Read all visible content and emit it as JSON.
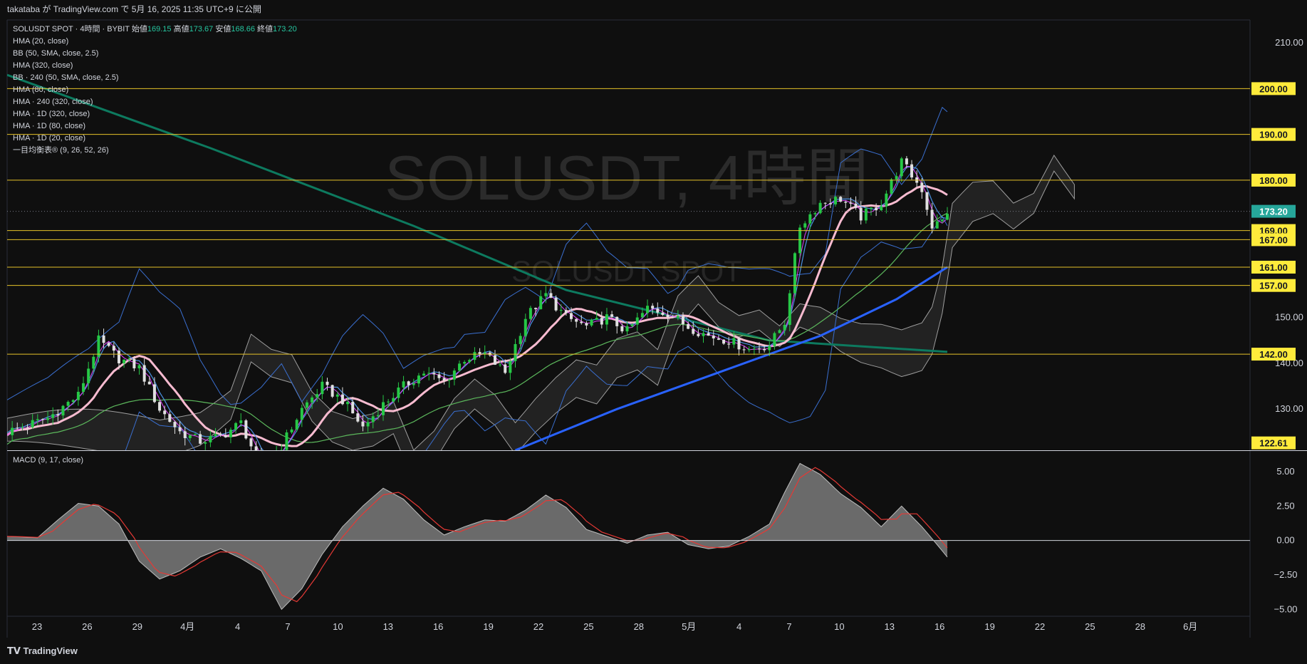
{
  "header": {
    "published": "takataba が TradingView.com で 5月 16, 2025 11:35 UTC+9 に公開"
  },
  "legend": {
    "symbol_line": "SOLUSDT SPOT · 4時間 · BYBIT",
    "open_label": "始値",
    "open": "169.15",
    "high_label": "高値",
    "high": "173.67",
    "low_label": "安値",
    "low": "168.66",
    "close_label": "終値",
    "close": "173.20",
    "indicators": [
      "HMA (20, close)",
      "BB (50, SMA, close, 2.5)",
      "HMA (320, close)",
      "BB · 240 (50, SMA, close, 2.5)",
      "HMA (80, close)",
      "HMA · 240 (320, close)",
      "HMA · 1D (320, close)",
      "HMA · 1D (80, close)",
      "HMA · 1D (20, close)",
      "一目均衡表® (9, 26, 52, 26)"
    ]
  },
  "watermark": {
    "main": "SOLUSDT, 4時間",
    "sub": "SOLUSDT SPOT"
  },
  "macd_panel": {
    "title": "MACD (9, 17, close)"
  },
  "branding": {
    "logo": "TradingView"
  },
  "chart_data": {
    "type": "candlestick",
    "timeframe": "4時間",
    "exchange": "BYBIT",
    "y_axis": {
      "range": [
        121,
        215
      ],
      "ticks": [
        130,
        140,
        150,
        210
      ]
    },
    "x_axis_labels": [
      "23",
      "26",
      "29",
      "4月",
      "4",
      "7",
      "10",
      "13",
      "16",
      "19",
      "22",
      "25",
      "28",
      "5月",
      "4",
      "7",
      "10",
      "13",
      "16",
      "19",
      "22",
      "25",
      "28",
      "6月"
    ],
    "current_price": 173.2,
    "price_labels": [
      200.0,
      190.0,
      180.0,
      173.2,
      169.0,
      167.0,
      161.0,
      157.0,
      142.0,
      122.61
    ],
    "horizontal_levels": [
      200,
      190,
      180,
      169,
      167,
      161,
      157,
      142
    ],
    "price_path_approx": [
      [
        0,
        125
      ],
      [
        8,
        128
      ],
      [
        14,
        133
      ],
      [
        18,
        145
      ],
      [
        22,
        141
      ],
      [
        26,
        139
      ],
      [
        30,
        130
      ],
      [
        34,
        125
      ],
      [
        38,
        123
      ],
      [
        42,
        124
      ],
      [
        46,
        127
      ],
      [
        50,
        117
      ],
      [
        54,
        122
      ],
      [
        58,
        130
      ],
      [
        62,
        135
      ],
      [
        66,
        132
      ],
      [
        70,
        126
      ],
      [
        74,
        131
      ],
      [
        78,
        135
      ],
      [
        82,
        138
      ],
      [
        86,
        136
      ],
      [
        90,
        141
      ],
      [
        94,
        142
      ],
      [
        98,
        138
      ],
      [
        102,
        150
      ],
      [
        106,
        155
      ],
      [
        110,
        150
      ],
      [
        114,
        148
      ],
      [
        118,
        150
      ],
      [
        122,
        147
      ],
      [
        126,
        152
      ],
      [
        130,
        151
      ],
      [
        134,
        148
      ],
      [
        138,
        146
      ],
      [
        142,
        145
      ],
      [
        146,
        143
      ],
      [
        150,
        144
      ],
      [
        153,
        149
      ],
      [
        156,
        170
      ],
      [
        160,
        175
      ],
      [
        164,
        176
      ],
      [
        168,
        172
      ],
      [
        172,
        175
      ],
      [
        176,
        184
      ],
      [
        180,
        178
      ],
      [
        182,
        170
      ],
      [
        184,
        171
      ],
      [
        185,
        173.2
      ]
    ],
    "macd": {
      "y_axis": {
        "range": [
          -5.5,
          6.5
        ],
        "ticks": [
          5.0,
          2.5,
          0.0,
          -2.5,
          -5.0
        ]
      },
      "histogram_approx": [
        [
          0,
          0.3
        ],
        [
          6,
          0.2
        ],
        [
          10,
          1.5
        ],
        [
          14,
          2.7
        ],
        [
          18,
          2.5
        ],
        [
          22,
          1.2
        ],
        [
          26,
          -1.5
        ],
        [
          30,
          -2.8
        ],
        [
          34,
          -2.2
        ],
        [
          38,
          -1.2
        ],
        [
          42,
          -0.6
        ],
        [
          46,
          -1.3
        ],
        [
          50,
          -2.2
        ],
        [
          54,
          -5.0
        ],
        [
          58,
          -3.5
        ],
        [
          62,
          -1.0
        ],
        [
          66,
          1.0
        ],
        [
          70,
          2.5
        ],
        [
          74,
          3.8
        ],
        [
          78,
          3.0
        ],
        [
          82,
          1.5
        ],
        [
          86,
          0.4
        ],
        [
          90,
          1.0
        ],
        [
          94,
          1.5
        ],
        [
          98,
          1.4
        ],
        [
          102,
          2.2
        ],
        [
          106,
          3.3
        ],
        [
          110,
          2.4
        ],
        [
          114,
          0.8
        ],
        [
          118,
          0.3
        ],
        [
          122,
          -0.2
        ],
        [
          126,
          0.4
        ],
        [
          130,
          0.6
        ],
        [
          134,
          -0.3
        ],
        [
          138,
          -0.6
        ],
        [
          142,
          -0.4
        ],
        [
          146,
          0.3
        ],
        [
          150,
          1.2
        ],
        [
          153,
          3.5
        ],
        [
          156,
          5.6
        ],
        [
          160,
          4.8
        ],
        [
          164,
          3.4
        ],
        [
          168,
          2.4
        ],
        [
          172,
          1.0
        ],
        [
          176,
          2.5
        ],
        [
          180,
          1.0
        ],
        [
          183,
          -0.3
        ],
        [
          185,
          -1.2
        ]
      ]
    },
    "series": [
      {
        "name": "HMA (20, close)",
        "color": "#4a90e2"
      },
      {
        "name": "BB (50, SMA, close, 2.5)",
        "color": "#3a6fd0"
      },
      {
        "name": "HMA (320, close)",
        "color": "#2962ff"
      },
      {
        "name": "HMA (80, close)",
        "color": "#f8bbd0"
      },
      {
        "name": "HMA · 240 (320, close)",
        "color": "#0d7a5f"
      },
      {
        "name": "一目均衡表® (9, 26, 52, 26)",
        "color": "#8c8c8c"
      }
    ]
  },
  "colors": {
    "up": "#26c846",
    "down": "#e0e0e0",
    "level": "#e6c229",
    "price_label_bg": "#ffeb3b",
    "current_bg": "#26a69a"
  }
}
